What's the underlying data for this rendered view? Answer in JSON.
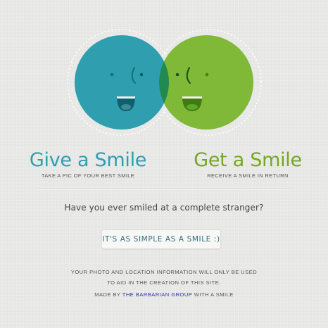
{
  "brand": {
    "teal": "#2f9fb0",
    "green": "#74a722",
    "overlap": "#218a52",
    "link": "#2e34a8"
  },
  "give": {
    "title": "Give a Smile",
    "subtitle": "TAKE A PIC OF YOUR BEST SMILE"
  },
  "get": {
    "title": "Get a Smile",
    "subtitle": "RECEIVE A SMILE IN RETURN"
  },
  "question": "Have you ever smiled at a complete stranger?",
  "cta_label": "IT'S AS SIMPLE AS A SMILE :)",
  "disclaimer": {
    "line1": "YOUR PHOTO AND LOCATION INFORMATION WILL ONLY BE USED",
    "line2": "TO AID IN THE CREATION OF THIS SITE."
  },
  "credits": {
    "prefix": "MADE BY",
    "link_text": "THE BARBARIAN GROUP",
    "suffix": "WITH A SMILE"
  },
  "icons": [
    "teal-smiley-face-icon",
    "green-smiley-face-icon"
  ]
}
